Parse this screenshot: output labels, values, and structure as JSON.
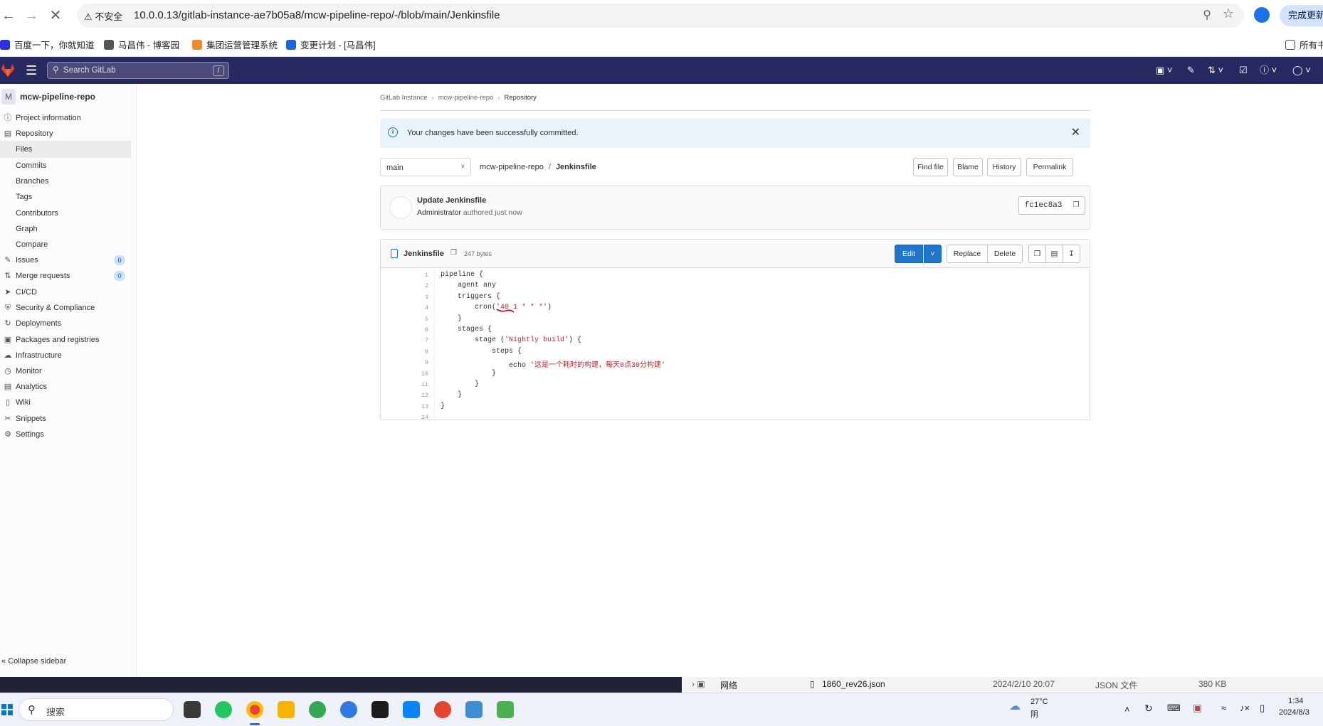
{
  "browser": {
    "security_warning": "不安全",
    "url": "10.0.0.13/gitlab-instance-ae7b05a8/mcw-pipeline-repo/-/blob/main/Jenkinsfile",
    "update_button": "完成更新",
    "bookmarks": [
      "百度一下，你就知道",
      "马昌伟 - 博客园",
      "集团运营管理系统",
      "变更计划 - [马昌伟]"
    ],
    "bookmarks_folder": "所有书"
  },
  "gitlab_header": {
    "search_placeholder": "Search GitLab",
    "search_shortcut": "/"
  },
  "sidebar": {
    "project_avatar": "M",
    "project_name": "mcw-pipeline-repo",
    "items": [
      {
        "label": "Project information",
        "icon": "info-icon"
      },
      {
        "label": "Repository",
        "icon": "doc-icon"
      },
      {
        "label": "Files",
        "sub": true
      },
      {
        "label": "Commits",
        "sub": true
      },
      {
        "label": "Branches",
        "sub": true
      },
      {
        "label": "Tags",
        "sub": true
      },
      {
        "label": "Contributors",
        "sub": true
      },
      {
        "label": "Graph",
        "sub": true
      },
      {
        "label": "Compare",
        "sub": true
      },
      {
        "label": "Issues",
        "icon": "issues-icon",
        "badge": "0"
      },
      {
        "label": "Merge requests",
        "icon": "merge-icon",
        "badge": "0"
      },
      {
        "label": "CI/CD",
        "icon": "rocket-icon"
      },
      {
        "label": "Security & Compliance",
        "icon": "shield-icon"
      },
      {
        "label": "Deployments",
        "icon": "deploy-icon"
      },
      {
        "label": "Packages and registries",
        "icon": "package-icon"
      },
      {
        "label": "Infrastructure",
        "icon": "cloud-icon"
      },
      {
        "label": "Monitor",
        "icon": "monitor-icon"
      },
      {
        "label": "Analytics",
        "icon": "chart-icon"
      },
      {
        "label": "Wiki",
        "icon": "book-icon"
      },
      {
        "label": "Snippets",
        "icon": "scissors-icon"
      },
      {
        "label": "Settings",
        "icon": "gear-icon"
      }
    ],
    "collapse_label": "Collapse sidebar"
  },
  "breadcrumb": [
    "GitLab Instance",
    "mcw-pipeline-repo",
    "Repository"
  ],
  "alert": {
    "message": "Your changes have been successfully committed."
  },
  "file_nav": {
    "branch": "main",
    "path_repo": "mcw-pipeline-repo",
    "path_sep": "/",
    "path_file": "Jenkinsfile",
    "buttons": [
      "Find file",
      "Blame",
      "History",
      "Permalink"
    ]
  },
  "commit": {
    "title": "Update Jenkinsfile",
    "author": "Administrator",
    "meta_suffix": "authored just now",
    "sha": "fc1ec8a3"
  },
  "file": {
    "name": "Jenkinsfile",
    "size": "247 bytes",
    "edit_label": "Edit",
    "replace_label": "Replace",
    "delete_label": "Delete",
    "lines": [
      {
        "n": "1",
        "code": "pipeline {",
        "str": ""
      },
      {
        "n": "2",
        "code": "    agent any",
        "str": ""
      },
      {
        "n": "3",
        "code": "    triggers {",
        "str": ""
      },
      {
        "n": "4",
        "code": "        cron(",
        "str": "'40 1 * * *'",
        "tail": ")"
      },
      {
        "n": "5",
        "code": "    }",
        "str": ""
      },
      {
        "n": "6",
        "code": "    stages {",
        "str": ""
      },
      {
        "n": "7",
        "code": "        stage (",
        "str": "'Nightly build'",
        "tail": ") {"
      },
      {
        "n": "8",
        "code": "            steps {",
        "str": ""
      },
      {
        "n": "9",
        "code": "                echo ",
        "str": "'这是一个耗时的构建，每天0点30分构建'",
        "tail": ""
      },
      {
        "n": "10",
        "code": "            }",
        "str": ""
      },
      {
        "n": "11",
        "code": "        }",
        "str": ""
      },
      {
        "n": "12",
        "code": "    }",
        "str": ""
      },
      {
        "n": "13",
        "code": "}",
        "str": ""
      },
      {
        "n": "14",
        "code": "",
        "str": ""
      }
    ]
  },
  "explorer_row": {
    "network": "网络",
    "filename": "1860_rev26.json",
    "date": "2024/2/10 20:07",
    "type": "JSON 文件",
    "size": "380 KB"
  },
  "taskbar": {
    "search": "搜索",
    "weather_temp": "27°C",
    "weather_desc": "阴",
    "time": "1:34",
    "date": "2024/8/3"
  }
}
